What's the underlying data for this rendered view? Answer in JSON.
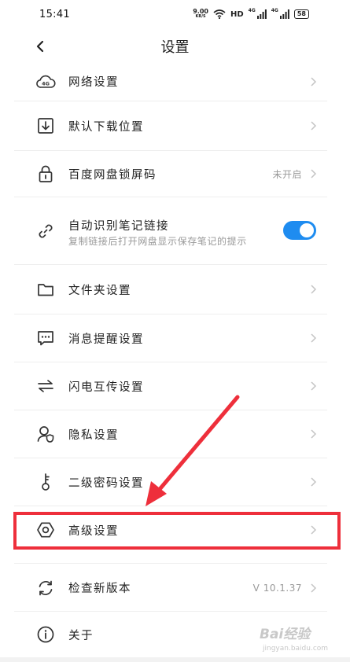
{
  "status_bar": {
    "time": "15:41",
    "net_speed_value": "9.00",
    "net_speed_unit": "KB/S",
    "hd_label": "HD",
    "signal_1_label": "4G",
    "signal_2_label": "4G",
    "battery": "58"
  },
  "header": {
    "title": "设置"
  },
  "settings": {
    "network": {
      "label": "网络设置",
      "icon": "cloud-4g-icon"
    },
    "download": {
      "label": "默认下载位置",
      "icon": "download-icon"
    },
    "lock": {
      "label": "百度网盘锁屏码",
      "value": "未开启",
      "icon": "lock-icon"
    },
    "note_link": {
      "label": "自动识别笔记链接",
      "sub": "复制链接后打开网盘显示保存笔记的提示",
      "enabled": true,
      "icon": "link-icon"
    },
    "folder": {
      "label": "文件夹设置",
      "icon": "folder-icon"
    },
    "message": {
      "label": "消息提醒设置",
      "icon": "message-icon"
    },
    "transfer": {
      "label": "闪电互传设置",
      "icon": "transfer-icon"
    },
    "privacy": {
      "label": "隐私设置",
      "icon": "privacy-icon"
    },
    "password": {
      "label": "二级密码设置",
      "icon": "key-icon"
    },
    "advanced": {
      "label": "高级设置",
      "icon": "gear-icon",
      "highlighted": true
    },
    "update": {
      "label": "检查新版本",
      "value": "V 10.1.37",
      "icon": "refresh-icon"
    },
    "about": {
      "label": "关于",
      "icon": "info-icon"
    }
  },
  "watermark": {
    "main": "Bai经验",
    "sub": "jingyan.baidu.com"
  },
  "colors": {
    "accent": "#1e8cf0",
    "annotation": "#ee2f3b"
  }
}
